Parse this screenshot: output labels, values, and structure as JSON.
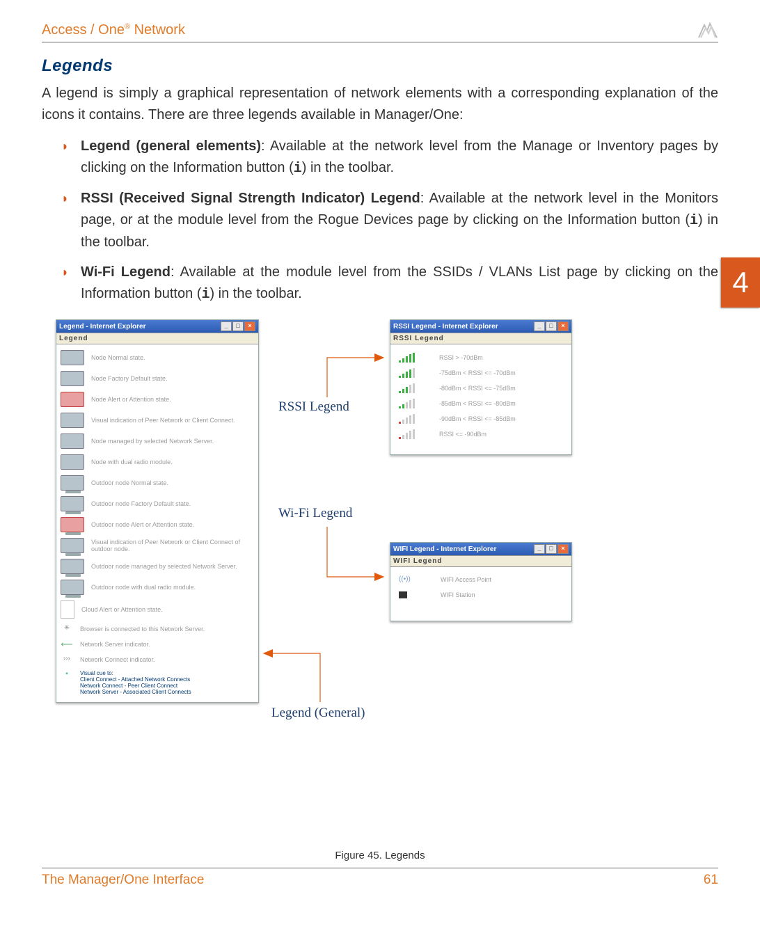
{
  "header": {
    "title_prefix": "Access / One",
    "title_suffix": " Network",
    "reg_mark": "®"
  },
  "chapter_tab": "4",
  "section_title": "Legends",
  "paragraph": "A legend is simply a graphical representation of network elements with a corresponding explanation of the icons it contains. There are three legends available in Manager/One:",
  "bullets": [
    {
      "label": "Legend (general elements)",
      "text": ": Available at the network level from the Manage or Inventory pages by clicking on the Information button (",
      "mono": "i",
      "text2": ") in the toolbar."
    },
    {
      "label": "RSSI (Received Signal Strength Indicator) Legend",
      "text": ": Available at the network level in the Monitors page, or at the module level from the Rogue Devices page by clicking on the Information button (",
      "mono": "i",
      "text2": ") in the toolbar."
    },
    {
      "label": "Wi-Fi Legend",
      "text": ": Available at the module level from the SSIDs / VLANs List page by clicking on the Information button (",
      "mono": "i",
      "text2": ") in the toolbar."
    }
  ],
  "legend_window": {
    "titlebar": "Legend - Internet Explorer",
    "header": "Legend",
    "rows": [
      "Node Normal state.",
      "Node Factory Default state.",
      "Node Alert or Attention state.",
      "Visual indication of Peer Network or Client Connect.",
      "Node managed by selected Network Server.",
      "Node with dual radio module.",
      "Outdoor node Normal state.",
      "Outdoor node Factory Default state.",
      "Outdoor node Alert or Attention state.",
      "Visual indication of Peer Network or Client Connect of outdoor node.",
      "Outdoor node managed by selected Network Server.",
      "Outdoor node with dual radio module.",
      "Cloud Alert or Attention state.",
      "Browser is connected to this Network Server.",
      "Network Server indicator.",
      "Network Connect indicator."
    ],
    "footer_lines": "Visual cue to:\nClient Connect - Attached Network Connects\nNetwork Connect - Peer Client Connect\nNetwork Server - Associated Client Connects"
  },
  "rssi_window": {
    "titlebar": "RSSI Legend - Internet Explorer",
    "header": "RSSI Legend",
    "rows": [
      "RSSI > -70dBm",
      "-75dBm < RSSI <= -70dBm",
      "-80dBm < RSSI <= -75dBm",
      "-85dBm < RSSI <= -80dBm",
      "-90dBm < RSSI <= -85dBm",
      "RSSI <= -90dBm"
    ]
  },
  "wifi_window": {
    "titlebar": "WIFI Legend - Internet Explorer",
    "header": "WIFI Legend",
    "rows": [
      "WIFI Access Point",
      "WIFI Station"
    ]
  },
  "callouts": {
    "rssi": "RSSI Legend",
    "wifi": "Wi-Fi Legend",
    "general": "Legend (General)"
  },
  "figure_caption": "Figure 45. Legends",
  "footer": {
    "left": "The Manager/One Interface",
    "right": "61"
  }
}
